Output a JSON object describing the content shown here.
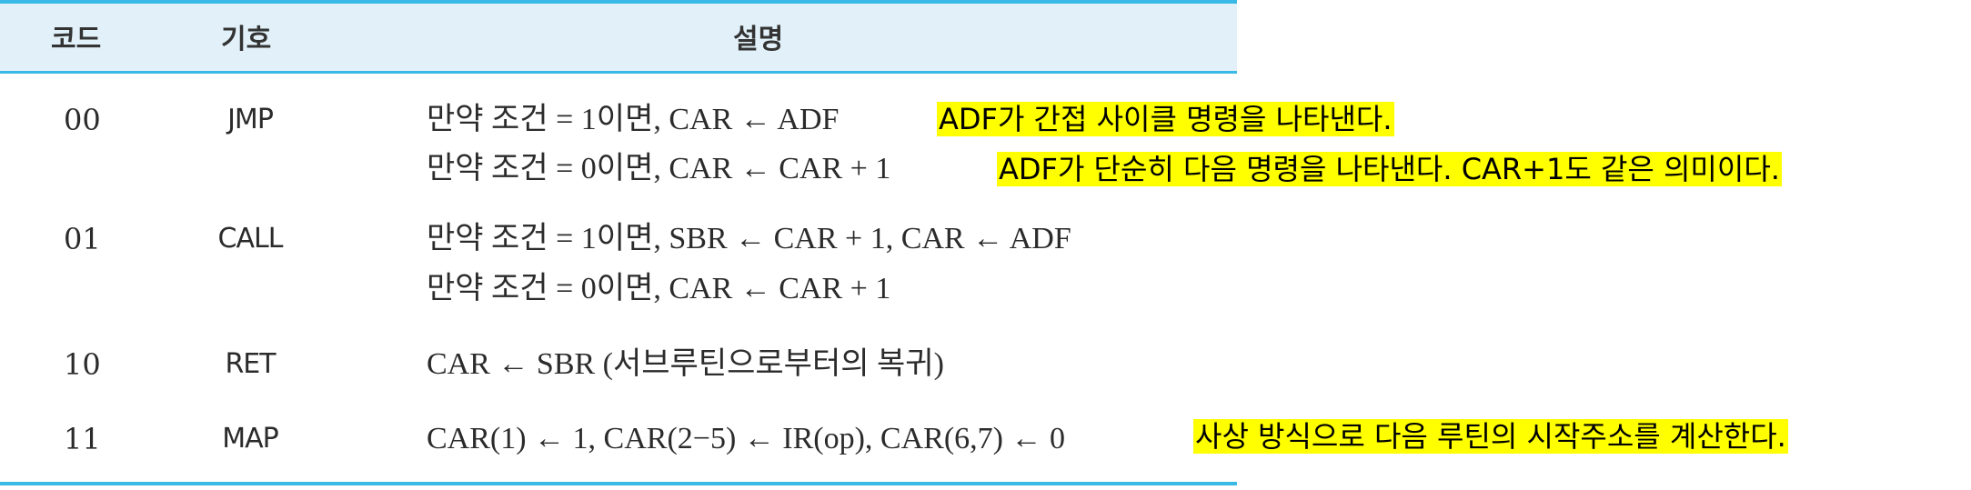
{
  "table": {
    "headers": {
      "code": "코드",
      "symbol": "기호",
      "description": "설명"
    },
    "rows": [
      {
        "code": "00",
        "symbol": "JMP",
        "lines": [
          "만약 조건 = 1이면, CAR ← ADF",
          "만약 조건 = 0이면, CAR ← CAR + 1"
        ]
      },
      {
        "code": "01",
        "symbol": "CALL",
        "lines": [
          "만약 조건 = 1이면, SBR ← CAR + 1, CAR ← ADF",
          "만약 조건 = 0이면, CAR ← CAR + 1"
        ]
      },
      {
        "code": "10",
        "symbol": "RET",
        "lines": [
          "CAR ← SBR (서브루틴으로부터의  복귀)"
        ]
      },
      {
        "code": "11",
        "symbol": "MAP",
        "lines": [
          "CAR(1) ← 1, CAR(2−5) ← IR(op), CAR(6,7) ← 0"
        ]
      }
    ]
  },
  "annotations": {
    "jmp_cond1": "ADF가 간접 사이클 명령을 나타낸다.",
    "jmp_cond0": "ADF가 단순히 다음 명령을 나타낸다. CAR+1도 같은 의미이다.",
    "map": "사상 방식으로 다음 루틴의 시작주소를 계산한다."
  },
  "colors": {
    "rule": "#39b9e6",
    "header_fill": "#e2f1f9",
    "highlight": "#ffff00"
  }
}
